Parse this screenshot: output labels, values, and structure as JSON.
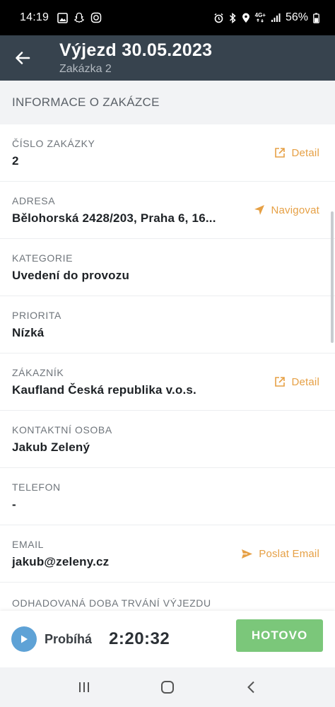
{
  "status_bar": {
    "time": "14:19",
    "network_label": "4G+",
    "battery_percent": "56%"
  },
  "app_bar": {
    "title": "Výjezd 30.05.2023",
    "subtitle": "Zakázka 2"
  },
  "section": {
    "header": "INFORMACE O ZAKÁZCE"
  },
  "fields": [
    {
      "label": "ČÍSLO ZAKÁZKY",
      "value": "2",
      "action": "Detail",
      "action_icon": "open-external-icon"
    },
    {
      "label": "ADRESA",
      "value": "Bělohorská 2428/203, Praha 6, 16...",
      "action": "Navigovat",
      "action_icon": "navigation-arrow-icon"
    },
    {
      "label": "KATEGORIE",
      "value": "Uvedení do provozu"
    },
    {
      "label": "PRIORITA",
      "value": "Nízká"
    },
    {
      "label": "ZÁKAZNÍK",
      "value": "Kaufland Česká republika v.o.s.",
      "action": "Detail",
      "action_icon": "open-external-icon"
    },
    {
      "label": "KONTAKTNÍ OSOBA",
      "value": "Jakub Zelený"
    },
    {
      "label": "TELEFON",
      "value": "-"
    },
    {
      "label": "EMAIL",
      "value": "jakub@zeleny.cz",
      "action": "Poslat Email",
      "action_icon": "send-icon"
    },
    {
      "label": "ODHADOVANÁ DOBA TRVÁNÍ VÝJEZDU"
    }
  ],
  "bottom_bar": {
    "status_label": "Probíhá",
    "timer": "2:20:32",
    "done_button": "HOTOVO"
  },
  "colors": {
    "app_bar_bg": "#37434e",
    "accent_orange": "#e6a045",
    "done_green": "#7bc77a",
    "play_blue": "#5ea2d6"
  }
}
